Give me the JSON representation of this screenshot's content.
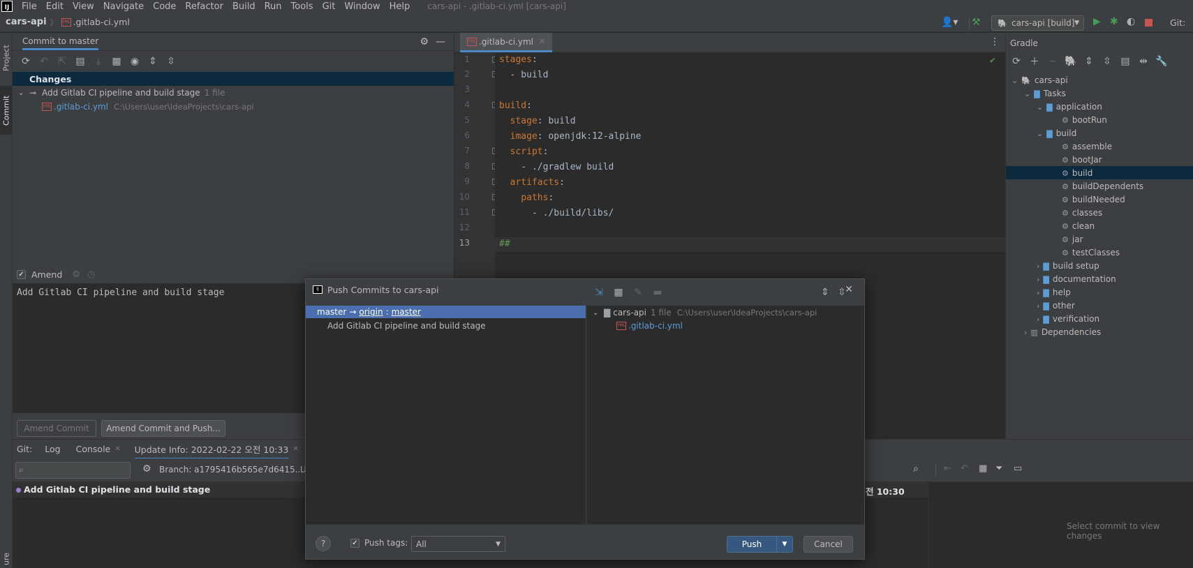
{
  "menubar": {
    "items": [
      "File",
      "Edit",
      "View",
      "Navigate",
      "Code",
      "Refactor",
      "Build",
      "Run",
      "Tools",
      "Git",
      "Window",
      "Help"
    ],
    "title": "cars-api - .gitlab-ci.yml [cars-api]"
  },
  "navbar": {
    "project": "cars-api",
    "file": ".gitlab-ci.yml",
    "run_config": "cars-api [build]",
    "git_label": "Git:"
  },
  "left_stripe": {
    "project": "Project",
    "commit": "Commit",
    "structure": "ure"
  },
  "commit_panel": {
    "tab": "Commit to master",
    "changes_header": "Changes",
    "changelist": "Add Gitlab CI pipeline and build stage",
    "changelist_count": "1 file",
    "file_name": ".gitlab-ci.yml",
    "file_path": "C:\\Users\\user\\IdeaProjects\\cars-api",
    "amend_label": "Amend",
    "commit_message": "Add Gitlab CI pipeline and build stage",
    "amend_commit_button": "Amend Commit",
    "amend_push_button": "Amend Commit and Push..."
  },
  "editor": {
    "tab": ".gitlab-ci.yml",
    "line_numbers": [
      "1",
      "2",
      "3",
      "4",
      "5",
      "6",
      "7",
      "8",
      "9",
      "10",
      "11",
      "12",
      "13"
    ]
  },
  "gradle": {
    "title": "Gradle",
    "root": "cars-api",
    "tasks": "Tasks",
    "application": "application",
    "bootRun": "bootRun",
    "build_group": "build",
    "build_tasks": [
      "assemble",
      "bootJar",
      "build",
      "buildDependents",
      "buildNeeded",
      "classes",
      "clean",
      "jar",
      "testClasses"
    ],
    "other_groups": [
      "build setup",
      "documentation",
      "help",
      "other",
      "verification"
    ],
    "dependencies": "Dependencies"
  },
  "bottom": {
    "git_label": "Git:",
    "tabs": [
      "Log",
      "Console",
      "Update Info: 2022-02-22 오전 10:33"
    ],
    "branch_filter": "Branch: a1795416b565e7d6415...",
    "user_filter_partial": "U",
    "commit_row": "Add Gitlab CI pipeline and build stage",
    "commit_time_partial": "전 10:30",
    "select_commit_hint": "Select commit to view changes"
  },
  "dialog": {
    "title": "Push Commits to cars-api",
    "branch_from": "master",
    "arrow": "→",
    "remote": "origin",
    "branch_to": "master",
    "commit": "Add Gitlab CI pipeline and build stage",
    "repo": "cars-api",
    "repo_count": "1 file",
    "repo_path": "C:\\Users\\user\\IdeaProjects\\cars-api",
    "file": ".gitlab-ci.yml",
    "help": "?",
    "push_tags_label": "Push tags:",
    "push_tags_value": "All",
    "push_button": "Push",
    "cancel_button": "Cancel"
  },
  "colors": {
    "accent": "#4a88c7",
    "selection": "#4b6eaf",
    "keyword": "#cc7832",
    "comment": "#629755"
  }
}
